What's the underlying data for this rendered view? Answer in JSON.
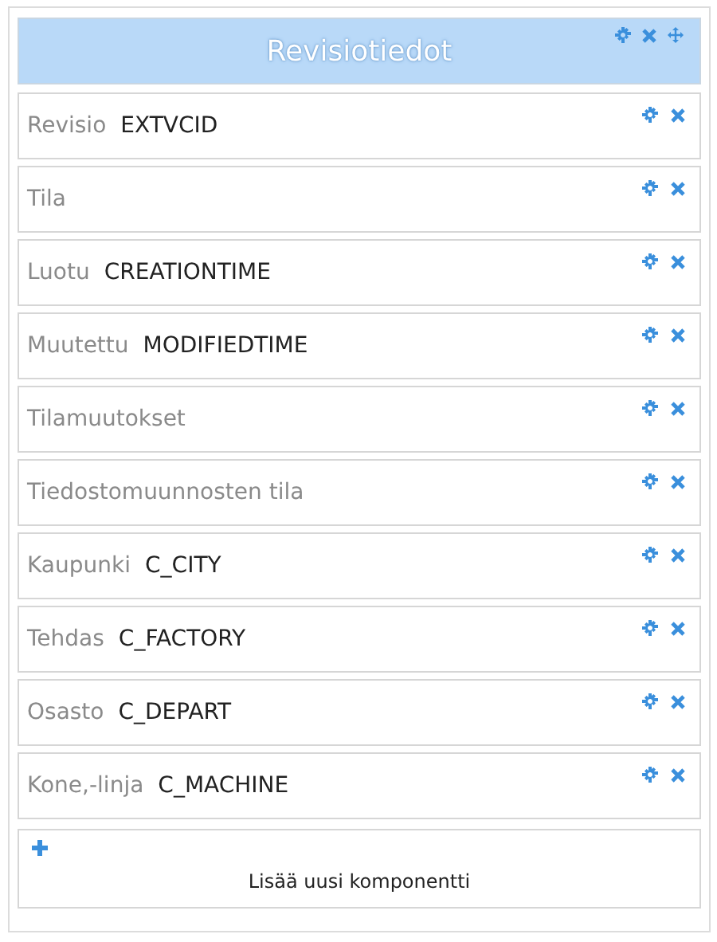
{
  "header": {
    "title": "Revisiotiedot"
  },
  "rows": [
    {
      "label": "Revisio",
      "value": "EXTVCID"
    },
    {
      "label": "Tila"
    },
    {
      "label": "Luotu",
      "value": "CREATIONTIME"
    },
    {
      "label": "Muutettu",
      "value": "MODIFIEDTIME"
    },
    {
      "label": "Tilamuutokset"
    },
    {
      "label": "Tiedostomuunnosten tila"
    },
    {
      "label": "Kaupunki",
      "value": "C_CITY"
    },
    {
      "label": "Tehdas",
      "value": "C_FACTORY"
    },
    {
      "label": "Osasto",
      "value": "C_DEPART"
    },
    {
      "label": "Kone,-linja",
      "value": "C_MACHINE"
    }
  ],
  "add_component": {
    "label": "Lisää uusi komponentti"
  }
}
